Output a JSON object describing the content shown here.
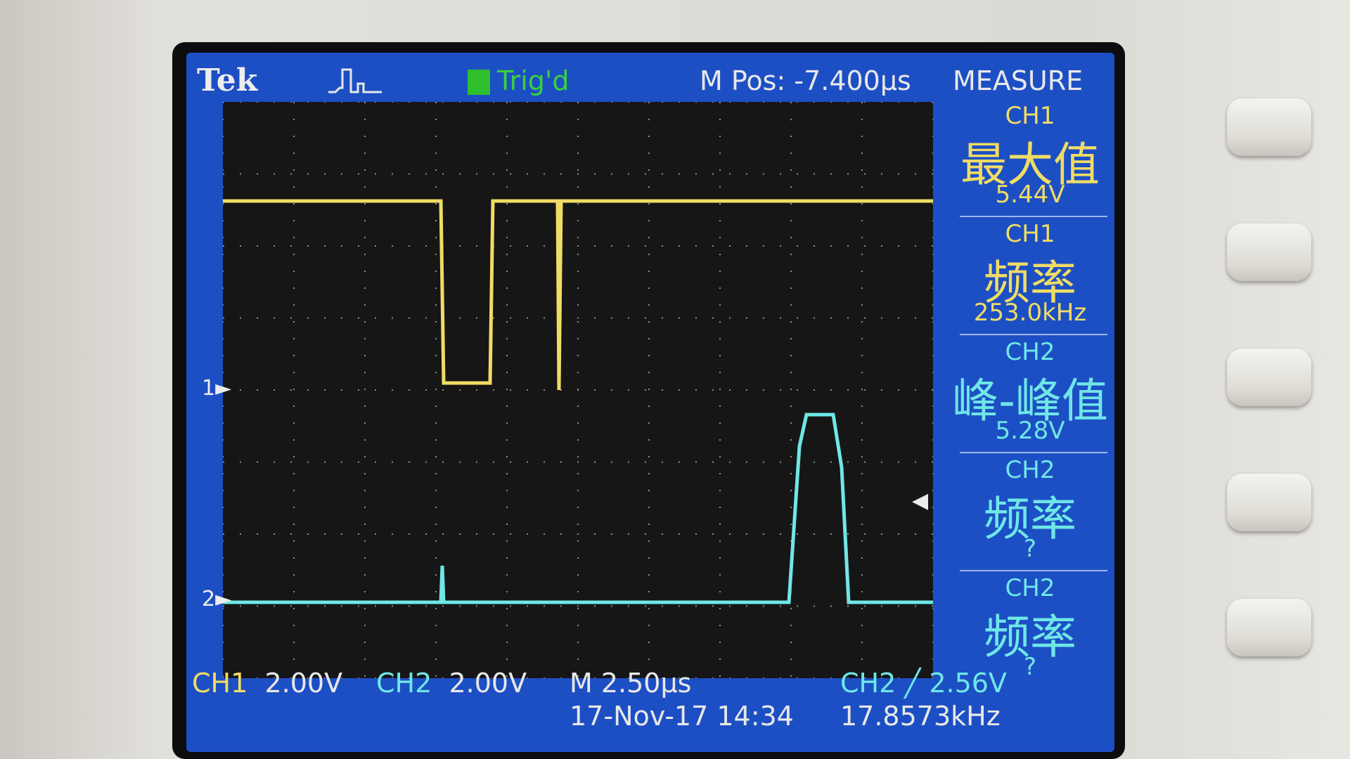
{
  "screen": {
    "brand": "Tek",
    "trigger_status": "Trig'd",
    "horizontal_position": "M Pos: -7.400µs",
    "menu_title": "MEASURE",
    "ch1_marker": "1",
    "ch2_marker": "2"
  },
  "measurements": [
    {
      "channel": "CH1",
      "name": "最大值",
      "value": "5.44V"
    },
    {
      "channel": "CH1",
      "name": "频率",
      "value": "253.0kHz"
    },
    {
      "channel": "CH2",
      "name": "峰-峰值",
      "value": "5.28V"
    },
    {
      "channel": "CH2",
      "name": "频率",
      "value": "?"
    },
    {
      "channel": "CH2",
      "name": "频率",
      "value": "?"
    }
  ],
  "readout": {
    "ch1_label": "CH1",
    "ch1_scale": "2.00V",
    "ch2_label": "CH2",
    "ch2_scale": "2.00V",
    "timebase": "M 2.50µs",
    "datetime": "17-Nov-17 14:34",
    "trigger": "CH2 ╱ 2.56V",
    "trigger_freq": "17.8573kHz"
  },
  "colors": {
    "ch1": "#f0dc64",
    "ch2": "#6fe7e7",
    "screen_bg": "#1d4fc4"
  },
  "buttons": [
    "menu-button",
    "menu-button",
    "menu-button",
    "menu-button",
    "menu-button"
  ]
}
